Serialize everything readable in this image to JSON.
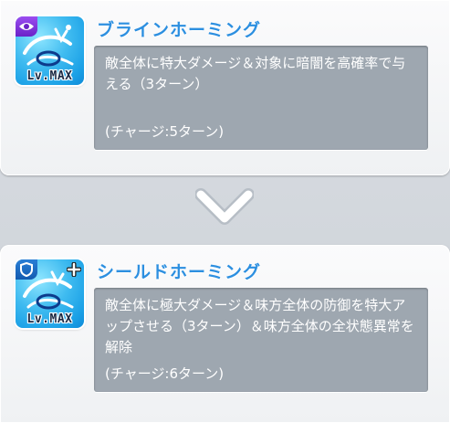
{
  "skills": [
    {
      "name": "ブラインホーミング",
      "level": "Lv.MAX",
      "description": "敵全体に特大ダメージ＆対象に暗闇を高確率で与える（3ターン）",
      "charge": "(チャージ:5ターン)",
      "badge_icon": "eye-icon",
      "badge_color": "#7a2fd8"
    },
    {
      "name": "シールドホーミング",
      "level": "Lv.MAX",
      "description": "敵全体に極大ダメージ＆味方全体の防御を特大アップさせる（3ターン）＆味方全体の全状態異常を解除",
      "charge": "(チャージ:6ターン)",
      "badge_icon": "shield-icon",
      "badge_color": "#1a6cc4",
      "extra_badge_icon": "plus-icon"
    }
  ],
  "divider": {
    "icon": "chevron-down-icon"
  },
  "colors": {
    "title": "#2c8fe0",
    "desc_bg": "#9ea7b0",
    "icon_bg": "#3fbbf0"
  }
}
